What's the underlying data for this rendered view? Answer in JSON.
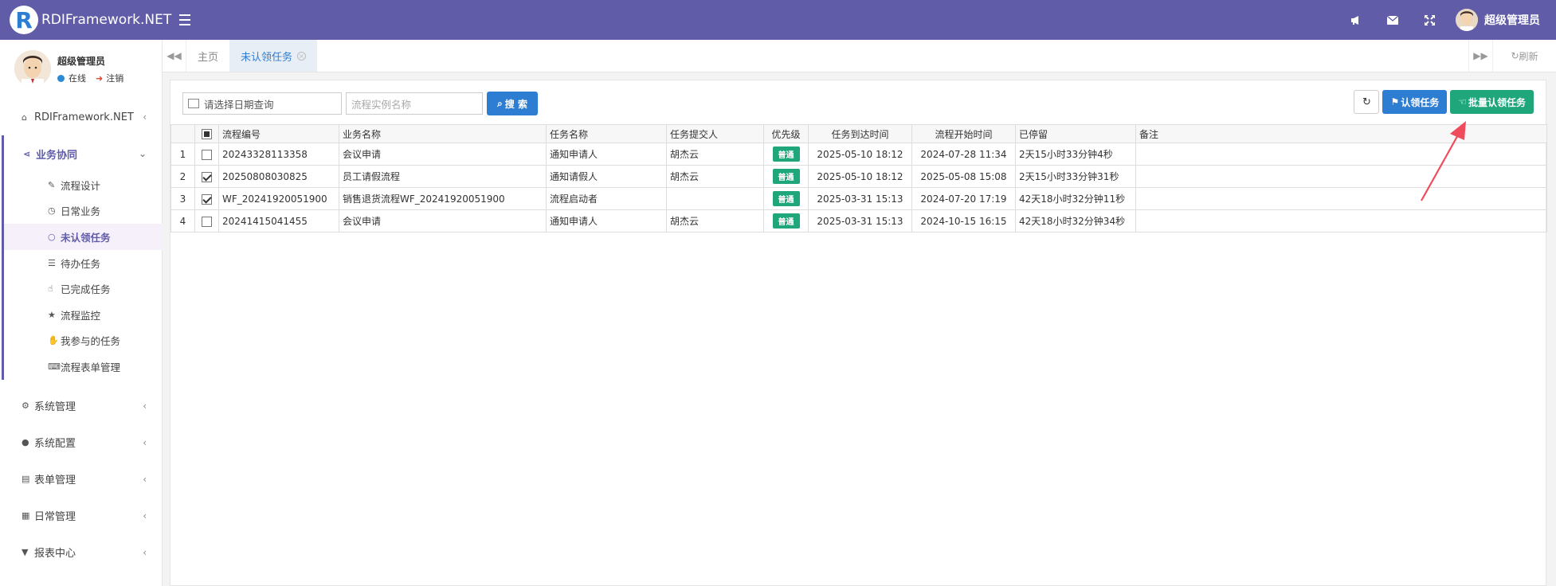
{
  "app": {
    "logo_letter": "R",
    "logo_text": "RDIFramework.NET"
  },
  "header": {
    "icons": [
      "bullhorn-icon",
      "envelope-icon",
      "fullscreen-icon"
    ],
    "user_name": "超级管理员"
  },
  "sidebar": {
    "user": {
      "name": "超级管理员",
      "status": "在线",
      "logout": "注销"
    },
    "menu": [
      {
        "label": "RDIFramework.NET",
        "icon": "home-icon"
      },
      {
        "label": "业务协同",
        "icon": "share-icon",
        "expanded": true
      },
      {
        "label": "系统管理",
        "icon": "gears-icon"
      },
      {
        "label": "系统配置",
        "icon": "circle-icon"
      },
      {
        "label": "表单管理",
        "icon": "form-icon"
      },
      {
        "label": "日常管理",
        "icon": "calendar-icon"
      },
      {
        "label": "报表中心",
        "icon": "filter-icon"
      }
    ],
    "submenu": [
      {
        "label": "流程设计",
        "icon": "edit-icon"
      },
      {
        "label": "日常业务",
        "icon": "clock-icon"
      },
      {
        "label": "未认领任务",
        "icon": "circle-o-icon",
        "active": true
      },
      {
        "label": "待办任务",
        "icon": "tasks-icon"
      },
      {
        "label": "已完成任务",
        "icon": "hand-icon"
      },
      {
        "label": "流程监控",
        "icon": "star-icon"
      },
      {
        "label": "我参与的任务",
        "icon": "hand-paper-icon"
      },
      {
        "label": "流程表单管理",
        "icon": "keyboard-icon"
      }
    ]
  },
  "tabs": {
    "items": [
      {
        "label": "主页"
      },
      {
        "label": "未认领任务",
        "active": true
      }
    ],
    "refresh_label": "刷新"
  },
  "toolbar": {
    "date_placeholder": "请选择日期查询",
    "name_placeholder": "流程实例名称",
    "search_label": "搜 索",
    "claim_label": "认领任务",
    "batch_claim_label": "批量认领任务"
  },
  "table": {
    "columns": [
      "流程编号",
      "业务名称",
      "任务名称",
      "任务提交人",
      "优先级",
      "任务到达时间",
      "流程开始时间",
      "已停留",
      "备注"
    ],
    "rows": [
      {
        "num": "1",
        "checked": false,
        "code": "20243328113358",
        "biz": "会议申请",
        "task": "通知申请人",
        "submitter": "胡杰云",
        "priority": "普通",
        "arrive": "2025-05-10 18:12",
        "start": "2024-07-28 11:34",
        "stay": "2天15小时33分钟4秒",
        "remark": ""
      },
      {
        "num": "2",
        "checked": true,
        "code": "20250808030825",
        "biz": "员工请假流程",
        "task": "通知请假人",
        "submitter": "胡杰云",
        "priority": "普通",
        "arrive": "2025-05-10 18:12",
        "start": "2025-05-08 15:08",
        "stay": "2天15小时33分钟31秒",
        "remark": ""
      },
      {
        "num": "3",
        "checked": true,
        "code": "WF_20241920051900",
        "biz": "销售退货流程WF_20241920051900",
        "task": "流程启动者",
        "submitter": "",
        "priority": "普通",
        "arrive": "2025-03-31 15:13",
        "start": "2024-07-20 17:19",
        "stay": "42天18小时32分钟11秒",
        "remark": ""
      },
      {
        "num": "4",
        "checked": false,
        "code": "20241415041455",
        "biz": "会议申请",
        "task": "通知申请人",
        "submitter": "胡杰云",
        "priority": "普通",
        "arrive": "2025-03-31 15:13",
        "start": "2024-10-15 16:15",
        "stay": "42天18小时32分钟34秒",
        "remark": ""
      }
    ]
  },
  "colors": {
    "header": "#605ca8",
    "primary": "#2d7dd2",
    "success": "#1fa67a",
    "annotation_arrow": "#ef4b5c"
  }
}
